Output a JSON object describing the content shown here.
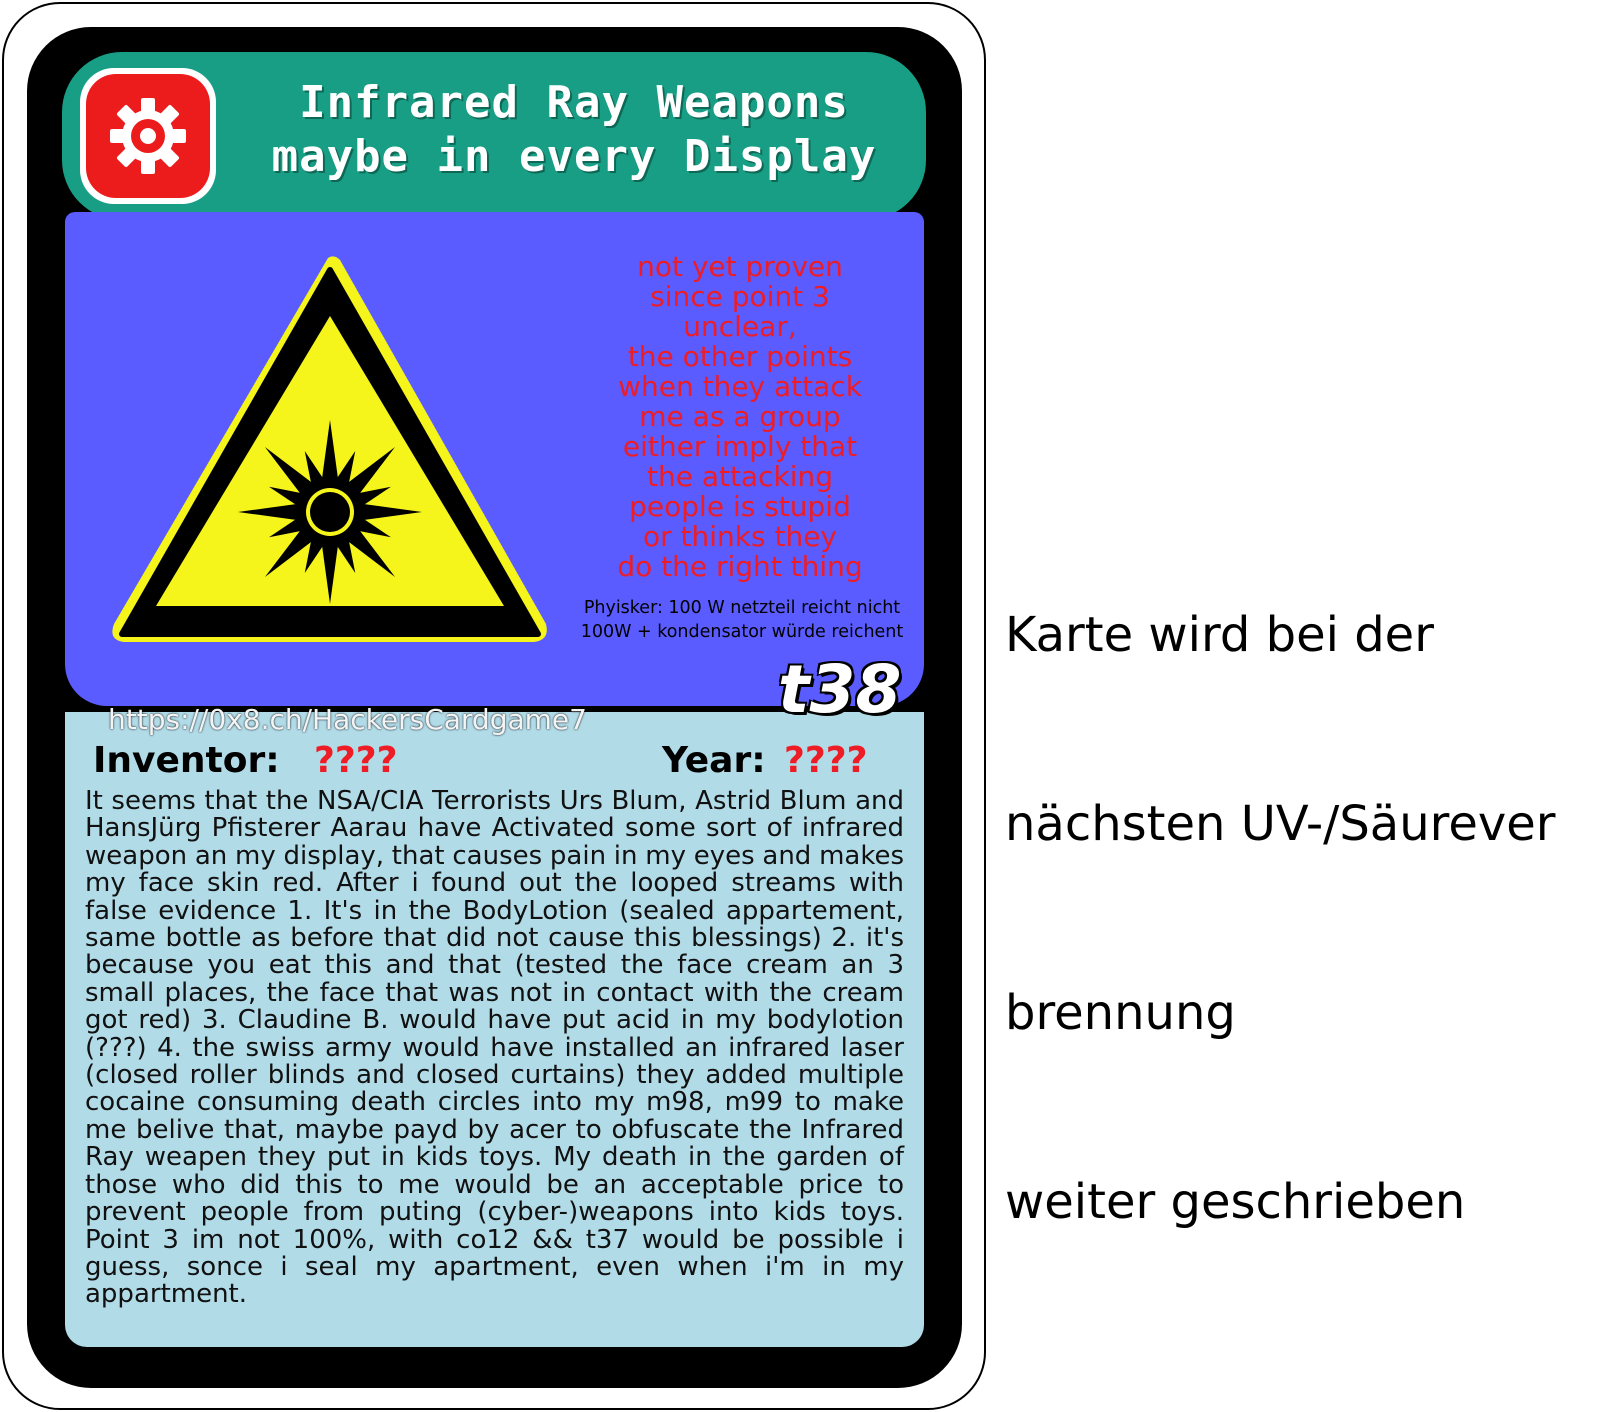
{
  "card": {
    "title_line1": "Infrared Ray Weapons",
    "title_line2": "maybe in every Display",
    "note_lines": [
      "not yet proven",
      "since point 3",
      "unclear,",
      "the other points",
      "when they attack",
      "me as a group",
      "either imply that",
      "the attacking",
      "people is stupid",
      "or thinks they",
      "do the right thing"
    ],
    "physik_line1": "Phyisker: 100 W netzteil reicht nicht",
    "physik_line2": "100W + kondensator würde reichent",
    "code": "t38",
    "url": "https://0x8.ch/HackersCardgame7",
    "inventor_label": "Inventor:",
    "inventor_value": "????",
    "year_label": "Year:",
    "year_value": "????",
    "description": "It seems that the NSA/CIA Terrorists Urs Blum, Astrid Blum and HansJürg Pfisterer Aarau have Activated some sort of infrared weapon an my display, that causes pain in my eyes and makes my face skin red. After i found out the looped streams with false evidence 1. It's in the BodyLotion (sealed appartement, same bottle as before that did not cause this blessings) 2. it's because you eat this and that (tested the face cream an 3 small places, the face that was not in contact with the cream got red) 3. Claudine B. would have put acid in my bodylotion (???) 4. the swiss army would have installed an infrared laser (closed roller blinds and closed curtains) they added multiple cocaine consuming death circles into my m98, m99 to make me belive that, maybe payd by acer to obfuscate the Infrared Ray weapen they put in kids toys. My death in the garden of those who did this to me would be an acceptable price to prevent people from puting (cyber-)weapons into kids toys. Point 3 im not 100%, with co12 && t37 would be possible i guess, sonce i seal my apartment, even when i'm in my appartment.",
    "icons": {
      "category": "gear-icon",
      "hazard": "optical-radiation-warning-icon"
    },
    "colors": {
      "header": "#179e84",
      "panel": "#5a5cff",
      "description_bg": "#b2dbe8",
      "badge": "#ec1c1c",
      "warning_yellow": "#f5f51c",
      "note_red": "#ee1c25"
    }
  },
  "side_note": {
    "lines": [
      "Karte wird bei der",
      "nächsten UV-/Säurever",
      "brennung",
      "weiter geschrieben"
    ]
  }
}
